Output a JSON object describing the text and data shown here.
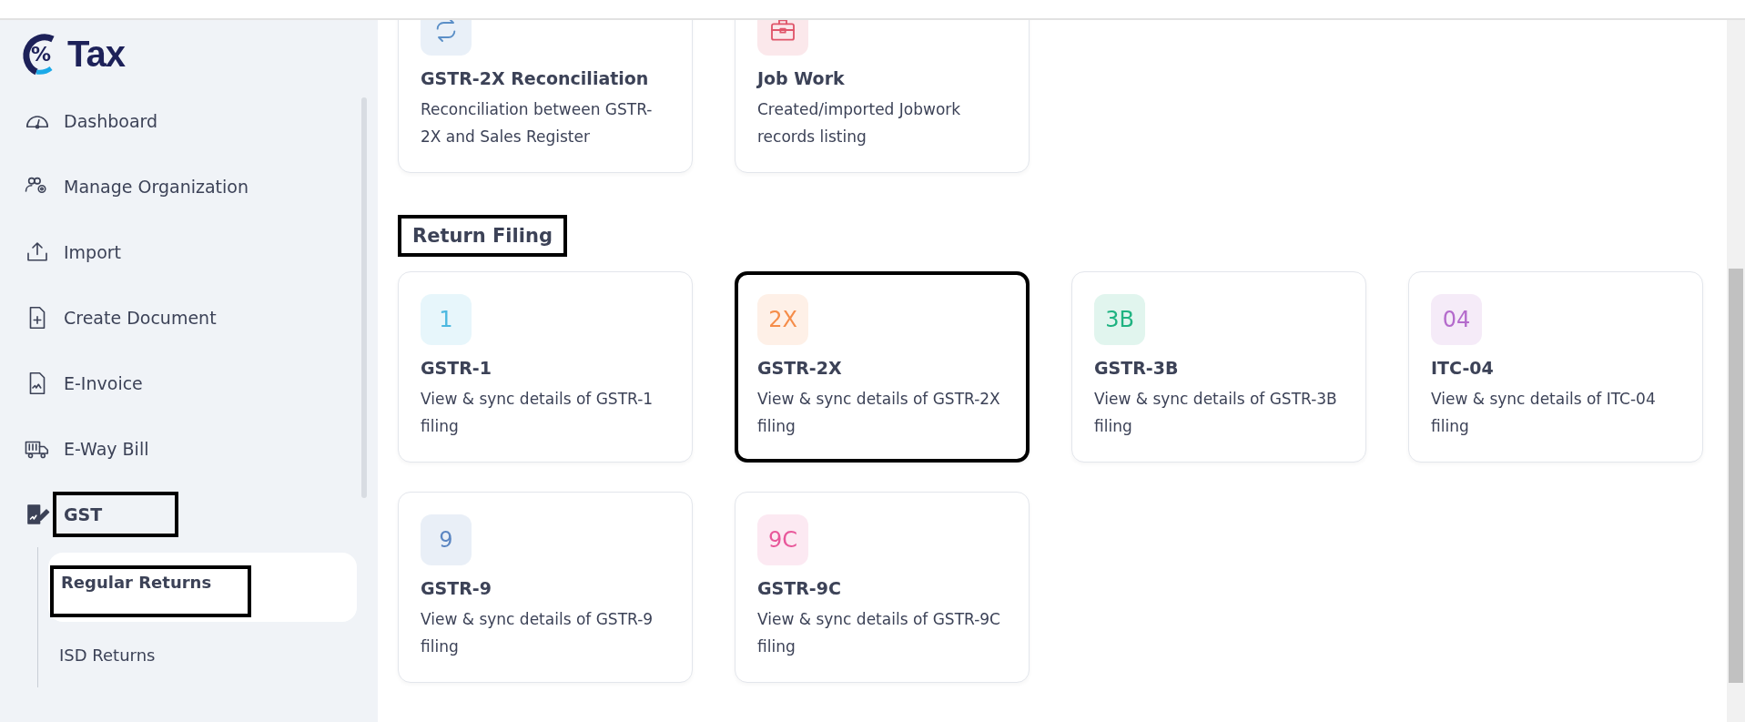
{
  "logo": {
    "mark": "%",
    "text": "Tax"
  },
  "sidebar": {
    "items": [
      {
        "label": "Dashboard",
        "selected": false,
        "highlighted": false
      },
      {
        "label": "Manage Organization",
        "selected": false,
        "highlighted": false
      },
      {
        "label": "Import",
        "selected": false,
        "highlighted": false
      },
      {
        "label": "Create Document",
        "selected": false,
        "highlighted": false
      },
      {
        "label": "E-Invoice",
        "selected": false,
        "highlighted": false
      },
      {
        "label": "E-Way Bill",
        "selected": false,
        "highlighted": false
      },
      {
        "label": "GST",
        "selected": true,
        "highlighted": true,
        "expanded": true,
        "children": [
          {
            "label": "Regular Returns",
            "selected": true,
            "highlighted": true
          },
          {
            "label": "ISD Returns",
            "selected": false,
            "highlighted": false
          }
        ]
      }
    ]
  },
  "tools": [
    {
      "title": "GSTR-2X Reconciliation",
      "description": "Reconciliation between GSTR-2X and Sales Register",
      "color": "#5b8fc7"
    },
    {
      "title": "Job Work",
      "description": "Created/imported Jobwork records listing",
      "color": "#e0566b"
    }
  ],
  "return_filing": {
    "heading": "Return Filing",
    "heading_highlighted": true,
    "cards": [
      {
        "badge": "1",
        "color": "#4bb8e0",
        "title": "GSTR-1",
        "description": "View & sync details of GSTR-1 filing",
        "highlighted": false
      },
      {
        "badge": "2X",
        "color": "#f58d4a",
        "title": "GSTR-2X",
        "description": "View & sync details of GSTR-2X filing",
        "highlighted": true
      },
      {
        "badge": "3B",
        "color": "#1fb381",
        "title": "GSTR-3B",
        "description": "View & sync details of GSTR-3B filing",
        "highlighted": false
      },
      {
        "badge": "04",
        "color": "#b46bcc",
        "title": "ITC-04",
        "description": "View & sync details of ITC-04 filing",
        "highlighted": false
      },
      {
        "badge": "9",
        "color": "#5b86c2",
        "title": "GSTR-9",
        "description": "View & sync details of GSTR-9 filing",
        "highlighted": false
      },
      {
        "badge": "9C",
        "color": "#e8579a",
        "title": "GSTR-9C",
        "description": "View & sync details of GSTR-9C filing",
        "highlighted": false
      }
    ]
  }
}
